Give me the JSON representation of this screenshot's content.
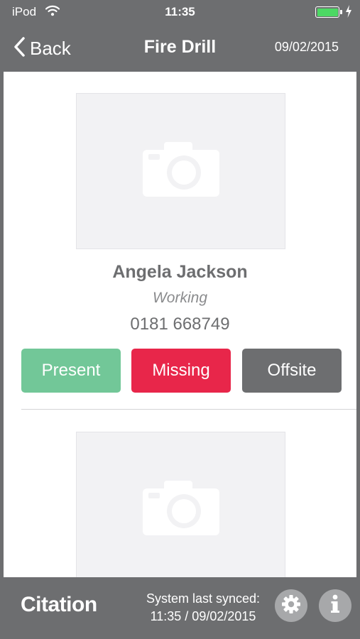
{
  "status_bar": {
    "carrier": "iPod",
    "time": "11:35",
    "battery_level": 1.0
  },
  "nav": {
    "back_label": "Back",
    "title": "Fire Drill",
    "date": "09/02/2015"
  },
  "person": {
    "name": "Angela Jackson",
    "role": "Working",
    "phone": "0181 668749"
  },
  "actions": {
    "present_label": "Present",
    "missing_label": "Missing",
    "offsite_label": "Offsite"
  },
  "footer": {
    "brand": "Citation",
    "sync_label": "System last synced:",
    "sync_value": "11:35 / 09/02/2015"
  },
  "colors": {
    "bar": "#6d6e70",
    "present": "#72c798",
    "missing": "#e8264a",
    "offsite": "#6d6e70",
    "battery": "#4cd964"
  },
  "icons": {
    "wifi": "wifi-icon",
    "charging": "lightning-bolt-icon",
    "back": "chevron-left-icon",
    "photo_placeholder": "camera-icon",
    "settings": "gear-icon",
    "info": "info-icon"
  }
}
